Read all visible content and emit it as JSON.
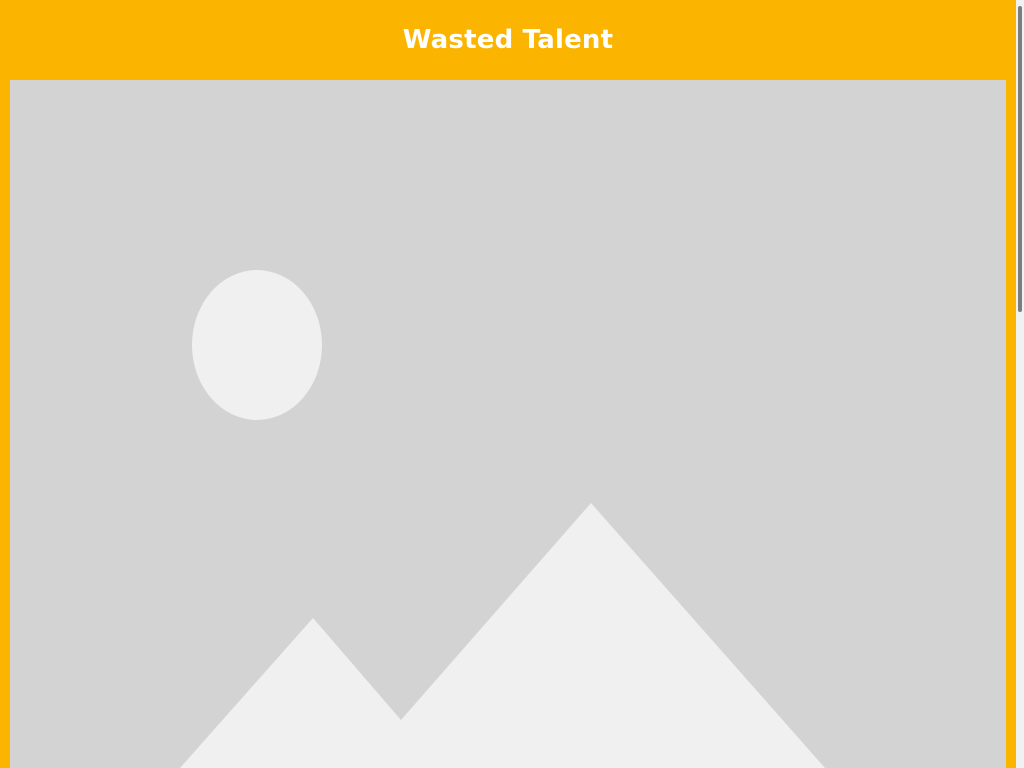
{
  "header": {
    "title": "Wasted Talent"
  },
  "main": {
    "image": {
      "icon": "image-placeholder-icon"
    }
  },
  "colors": {
    "accent": "#FBB500",
    "title_text": "#FFFFFF",
    "placeholder_bg": "#D3D3D3",
    "placeholder_shapes": "#F0F0F0",
    "scrollbar_track": "#F1F1F1",
    "scrollbar_thumb": "#7D7D7D"
  }
}
